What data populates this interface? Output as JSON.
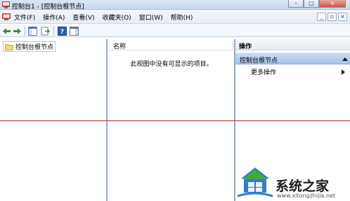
{
  "window": {
    "title": "控制台1 - [控制台根节点]",
    "buttons": [
      "–",
      "□",
      "×"
    ]
  },
  "menubar": {
    "items": [
      "文件(F)",
      "操作(A)",
      "查看(V)",
      "收藏夹(O)",
      "窗口(W)",
      "帮助(H)"
    ],
    "mdi_buttons": [
      "_",
      "▫",
      "×"
    ]
  },
  "tree": {
    "root_label": "控制台根节点"
  },
  "list": {
    "column_name": "名称",
    "empty_message": "此视图中没有可显示的项目。"
  },
  "actions": {
    "title": "操作",
    "section_label": "控制台根节点",
    "item_more": "更多操作"
  },
  "watermark": {
    "brand": "系统之家",
    "url": "www.xitongzhijia.net"
  },
  "colors": {
    "selection": "#a9c3e8",
    "divider_line": "#b02828"
  }
}
